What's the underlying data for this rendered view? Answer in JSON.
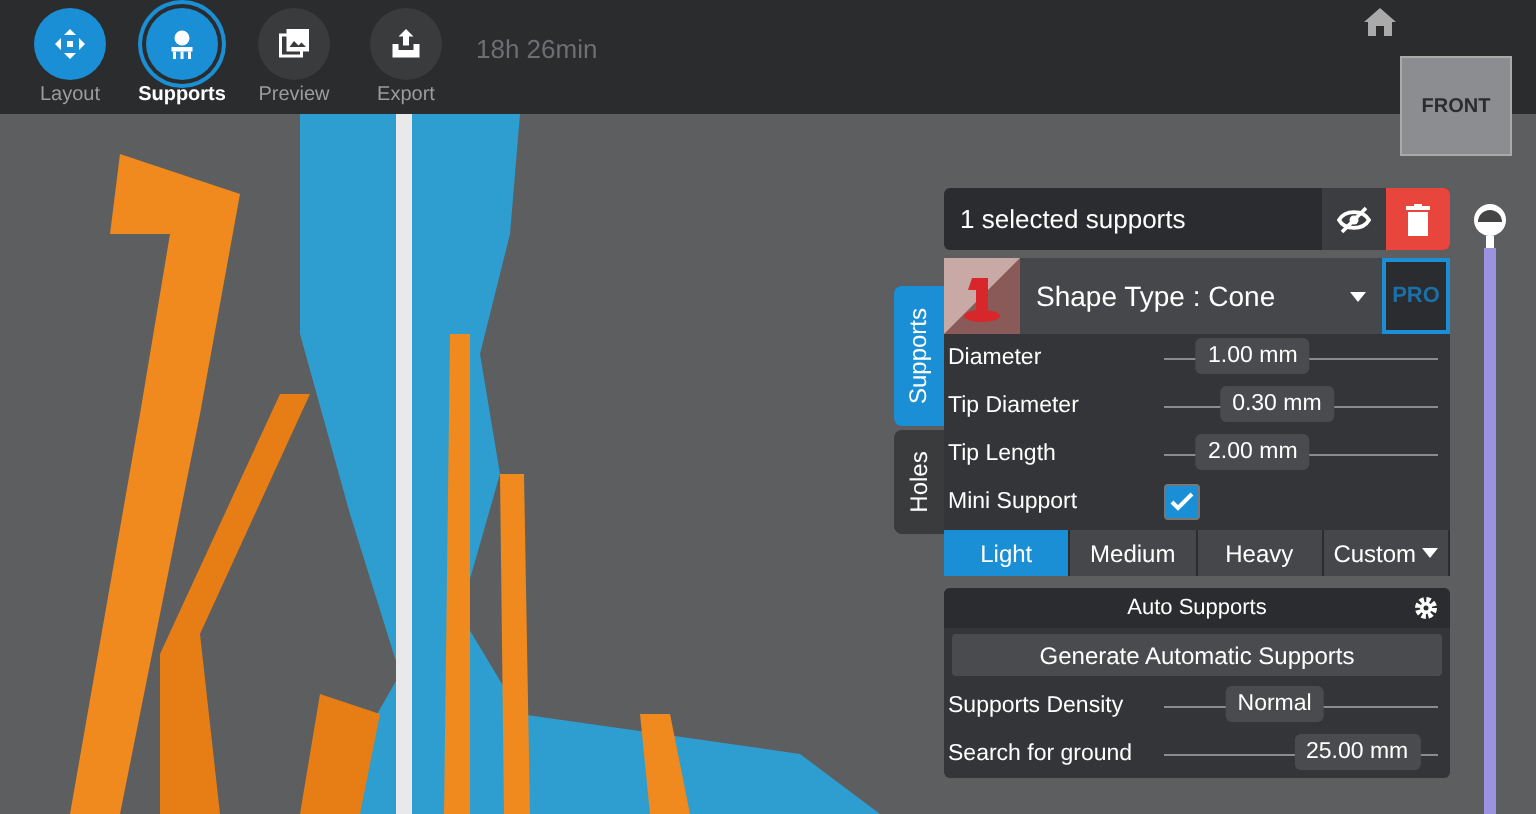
{
  "steps": [
    {
      "label": "Layout",
      "selected": false,
      "kind": "layout"
    },
    {
      "label": "Supports",
      "selected": true,
      "kind": "supports"
    },
    {
      "label": "Preview",
      "selected": false,
      "kind": "preview"
    },
    {
      "label": "Export",
      "selected": false,
      "kind": "export"
    }
  ],
  "print_time": "18h 26min",
  "view_cube": {
    "label": "FRONT"
  },
  "side_tabs": [
    {
      "label": "Supports",
      "selected": true
    },
    {
      "label": "Holes",
      "selected": false
    }
  ],
  "selection": {
    "title": "1 selected supports"
  },
  "shape": {
    "label": "Shape Type : Cone",
    "badge": "PRO"
  },
  "parameters": [
    {
      "label": "Diameter",
      "reading": "1.00 mm",
      "level": 0.2
    },
    {
      "label": "Tip Diameter",
      "reading": "0.30 mm",
      "level": 0.35
    },
    {
      "label": "Tip Length",
      "reading": "2.00 mm",
      "level": 0.2
    }
  ],
  "mini_support": {
    "label": "Mini Support",
    "checked": true
  },
  "presets": [
    {
      "label": "Light",
      "selected": true
    },
    {
      "label": "Medium",
      "selected": false
    },
    {
      "label": "Heavy",
      "selected": false
    },
    {
      "label": "Custom",
      "selected": false
    }
  ],
  "auto_supports": {
    "title": "Auto Supports",
    "button": "Generate Automatic Supports",
    "settings": [
      {
        "label": "Supports Density",
        "reading": "Normal",
        "level": 0.35
      },
      {
        "label": "Search for ground",
        "reading": "25.00 mm",
        "level": 0.88
      }
    ]
  },
  "layer_slider": {
    "level": 1
  }
}
